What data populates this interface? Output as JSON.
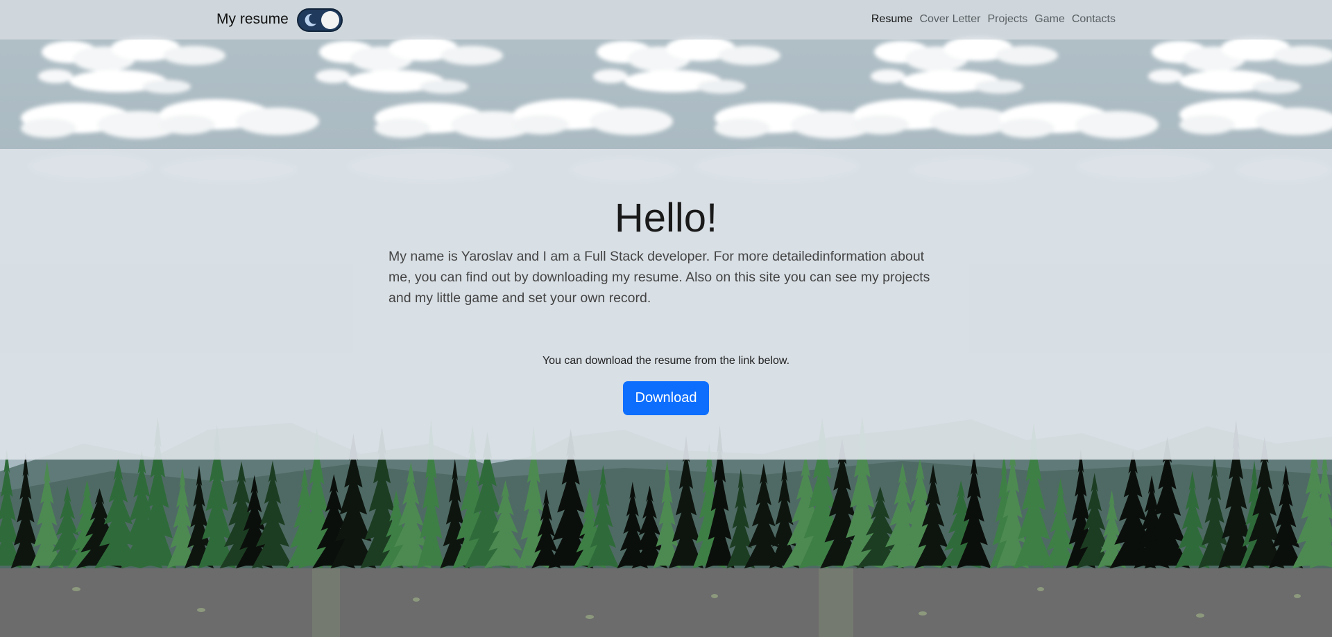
{
  "navbar": {
    "brand": "My resume",
    "theme_toggle_icon": "moon-icon",
    "links": [
      {
        "label": "Resume",
        "active": true
      },
      {
        "label": "Cover Letter",
        "active": false
      },
      {
        "label": "Projects",
        "active": false
      },
      {
        "label": "Game",
        "active": false
      },
      {
        "label": "Contacts",
        "active": false
      }
    ]
  },
  "main": {
    "heading": "Hello!",
    "intro": "My name is Yaroslav and I am a Full Stack developer. For more detailedinformation about me, you can find out by downloading my resume. Also on this site you can see my projects and my little game and set your own record.",
    "download_text": "You can download the resume from the link below.",
    "download_button": "Download"
  },
  "colors": {
    "accent": "#0d6efd",
    "toggle_bg": "#1f3a5c",
    "sky": "#a9b9c1",
    "ground": "#6c6c6c"
  }
}
